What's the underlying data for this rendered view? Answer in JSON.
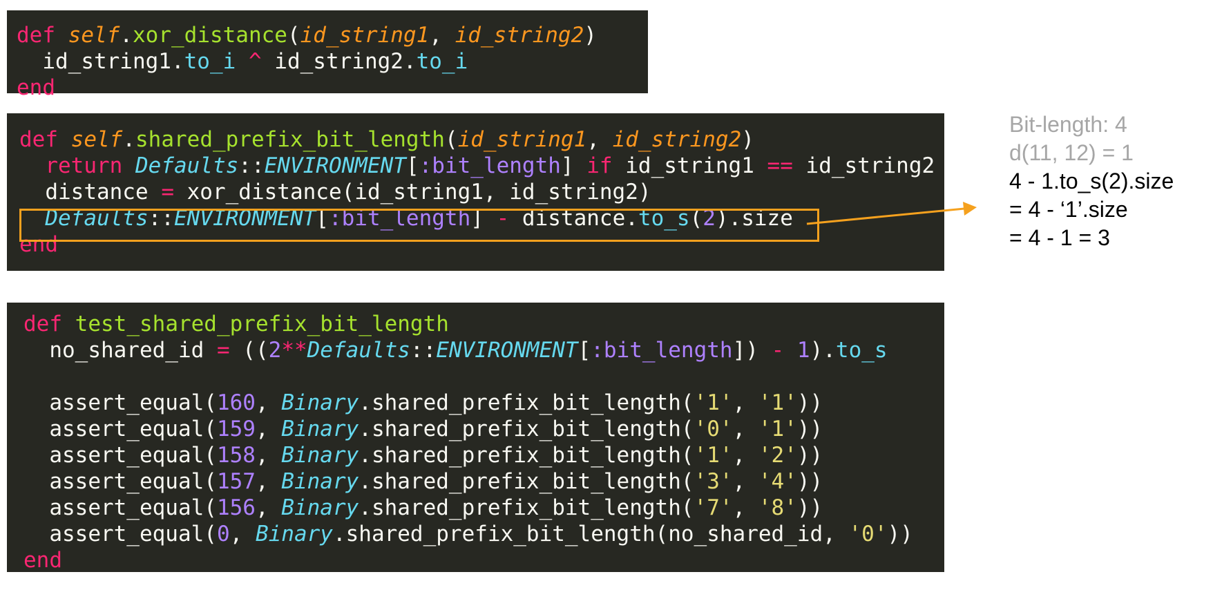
{
  "panels": {
    "xor_distance": {
      "lines": [
        [
          [
            "kw",
            "def"
          ],
          [
            "plain",
            " "
          ],
          [
            "slf",
            "self"
          ],
          [
            "plain",
            "."
          ],
          [
            "fn",
            "xor_distance"
          ],
          [
            "plain",
            "("
          ],
          [
            "arg",
            "id_string1"
          ],
          [
            "plain",
            ", "
          ],
          [
            "arg",
            "id_string2"
          ],
          [
            "plain",
            ")"
          ]
        ],
        [
          [
            "plain",
            "  id_string1."
          ],
          [
            "mth",
            "to_i"
          ],
          [
            "plain",
            " "
          ],
          [
            "op",
            "^"
          ],
          [
            "plain",
            " id_string2."
          ],
          [
            "mth",
            "to_i"
          ]
        ],
        [
          [
            "kw",
            "end"
          ]
        ]
      ]
    },
    "shared_prefix": {
      "lines": [
        [
          [
            "kw",
            "def"
          ],
          [
            "plain",
            " "
          ],
          [
            "slf",
            "self"
          ],
          [
            "plain",
            "."
          ],
          [
            "fn",
            "shared_prefix_bit_length"
          ],
          [
            "plain",
            "("
          ],
          [
            "arg",
            "id_string1"
          ],
          [
            "plain",
            ", "
          ],
          [
            "arg",
            "id_string2"
          ],
          [
            "plain",
            ")"
          ]
        ],
        [
          [
            "plain",
            "  "
          ],
          [
            "kw",
            "return"
          ],
          [
            "plain",
            " "
          ],
          [
            "cls",
            "Defaults"
          ],
          [
            "plain",
            "::"
          ],
          [
            "cls",
            "ENVIRONMENT"
          ],
          [
            "plain",
            "["
          ],
          [
            "sym",
            ":bit_length"
          ],
          [
            "plain",
            "] "
          ],
          [
            "kw",
            "if"
          ],
          [
            "plain",
            " id_string1 "
          ],
          [
            "op",
            "=="
          ],
          [
            "plain",
            " id_string2"
          ]
        ],
        [
          [
            "plain",
            "  distance "
          ],
          [
            "op",
            "="
          ],
          [
            "plain",
            " xor_distance(id_string1, id_string2)"
          ]
        ],
        [
          [
            "plain",
            "  "
          ],
          [
            "cls",
            "Defaults"
          ],
          [
            "plain",
            "::"
          ],
          [
            "cls",
            "ENVIRONMENT"
          ],
          [
            "plain",
            "["
          ],
          [
            "sym",
            ":bit_length"
          ],
          [
            "plain",
            "] "
          ],
          [
            "op",
            "-"
          ],
          [
            "plain",
            " distance."
          ],
          [
            "mth",
            "to_s"
          ],
          [
            "plain",
            "("
          ],
          [
            "num",
            "2"
          ],
          [
            "plain",
            ").size"
          ]
        ],
        [
          [
            "kw",
            "end"
          ]
        ]
      ]
    },
    "test": {
      "lines": [
        [
          [
            "kw",
            "def"
          ],
          [
            "plain",
            " "
          ],
          [
            "fn",
            "test_shared_prefix_bit_length"
          ]
        ],
        [
          [
            "plain",
            "  no_shared_id "
          ],
          [
            "op",
            "="
          ],
          [
            "plain",
            " (("
          ],
          [
            "num",
            "2"
          ],
          [
            "op",
            "**"
          ],
          [
            "cls",
            "Defaults"
          ],
          [
            "plain",
            "::"
          ],
          [
            "cls",
            "ENVIRONMENT"
          ],
          [
            "plain",
            "["
          ],
          [
            "sym",
            ":bit_length"
          ],
          [
            "plain",
            "]) "
          ],
          [
            "op",
            "-"
          ],
          [
            "plain",
            " "
          ],
          [
            "num",
            "1"
          ],
          [
            "plain",
            ")."
          ],
          [
            "mth",
            "to_s"
          ]
        ],
        [
          [
            "plain",
            ""
          ]
        ],
        [
          [
            "plain",
            "  assert_equal("
          ],
          [
            "num",
            "160"
          ],
          [
            "plain",
            ", "
          ],
          [
            "cls",
            "Binary"
          ],
          [
            "plain",
            ".shared_prefix_bit_length("
          ],
          [
            "str",
            "'1'"
          ],
          [
            "plain",
            ", "
          ],
          [
            "str",
            "'1'"
          ],
          [
            "plain",
            "))"
          ]
        ],
        [
          [
            "plain",
            "  assert_equal("
          ],
          [
            "num",
            "159"
          ],
          [
            "plain",
            ", "
          ],
          [
            "cls",
            "Binary"
          ],
          [
            "plain",
            ".shared_prefix_bit_length("
          ],
          [
            "str",
            "'0'"
          ],
          [
            "plain",
            ", "
          ],
          [
            "str",
            "'1'"
          ],
          [
            "plain",
            "))"
          ]
        ],
        [
          [
            "plain",
            "  assert_equal("
          ],
          [
            "num",
            "158"
          ],
          [
            "plain",
            ", "
          ],
          [
            "cls",
            "Binary"
          ],
          [
            "plain",
            ".shared_prefix_bit_length("
          ],
          [
            "str",
            "'1'"
          ],
          [
            "plain",
            ", "
          ],
          [
            "str",
            "'2'"
          ],
          [
            "plain",
            "))"
          ]
        ],
        [
          [
            "plain",
            "  assert_equal("
          ],
          [
            "num",
            "157"
          ],
          [
            "plain",
            ", "
          ],
          [
            "cls",
            "Binary"
          ],
          [
            "plain",
            ".shared_prefix_bit_length("
          ],
          [
            "str",
            "'3'"
          ],
          [
            "plain",
            ", "
          ],
          [
            "str",
            "'4'"
          ],
          [
            "plain",
            "))"
          ]
        ],
        [
          [
            "plain",
            "  assert_equal("
          ],
          [
            "num",
            "156"
          ],
          [
            "plain",
            ", "
          ],
          [
            "cls",
            "Binary"
          ],
          [
            "plain",
            ".shared_prefix_bit_length("
          ],
          [
            "str",
            "'7'"
          ],
          [
            "plain",
            ", "
          ],
          [
            "str",
            "'8'"
          ],
          [
            "plain",
            "))"
          ]
        ],
        [
          [
            "plain",
            "  assert_equal("
          ],
          [
            "num",
            "0"
          ],
          [
            "plain",
            ", "
          ],
          [
            "cls",
            "Binary"
          ],
          [
            "plain",
            ".shared_prefix_bit_length(no_shared_id, "
          ],
          [
            "str",
            "'0'"
          ],
          [
            "plain",
            "))"
          ]
        ],
        [
          [
            "kw",
            "end"
          ]
        ]
      ]
    }
  },
  "notes": {
    "bit_length": "Bit-length: 4",
    "distance": "d(11, 12) = 1",
    "step1": "4 - 1.to_s(2).size",
    "step2": "= 4 - ‘1’.size",
    "step3": "= 4 - 1 = 3"
  },
  "colors": {
    "editor_background": "#272822",
    "highlight": "#f5a11e",
    "keyword": "#f92672",
    "function": "#a6e22e",
    "argument": "#fd971f",
    "constant": "#66d9ef",
    "symbol": "#ae81ff",
    "string": "#e6db74"
  }
}
